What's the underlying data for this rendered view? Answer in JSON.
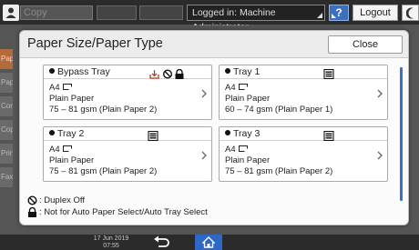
{
  "topbar": {
    "copy_tab_label": "Copy",
    "login_status": "Logged in: Machine Administrator",
    "help_label": "?",
    "logout_label": "Logout"
  },
  "background_tabs": [
    "Pap",
    "Pap",
    "Com",
    "Cop",
    "Prin",
    "Fax"
  ],
  "dialog": {
    "title": "Paper Size/Paper Type",
    "close_label": "Close"
  },
  "trays": [
    {
      "name": "Bypass Tray",
      "size": "A4",
      "type": "Plain Paper",
      "weight": "75 – 81 gsm (Plain Paper 2)"
    },
    {
      "name": "Tray 1",
      "size": "A4",
      "type": "Plain Paper",
      "weight": "60 – 74 gsm (Plain Paper 1)"
    },
    {
      "name": "Tray 2",
      "size": "A4",
      "type": "Plain Paper",
      "weight": "75 – 81 gsm (Plain Paper 2)"
    },
    {
      "name": "Tray 3",
      "size": "A4",
      "type": "Plain Paper",
      "weight": "75 – 81 gsm (Plain Paper 2)"
    }
  ],
  "legend": {
    "duplex_off": ": Duplex Off",
    "not_auto_select": ": Not for Auto Paper Select/Auto Tray Select"
  },
  "bottombar": {
    "date": "17 Jun 2019",
    "time": "07:55"
  },
  "colors": {
    "accent_blue": "#2f67c7",
    "bypass_red": "#c0392b"
  }
}
